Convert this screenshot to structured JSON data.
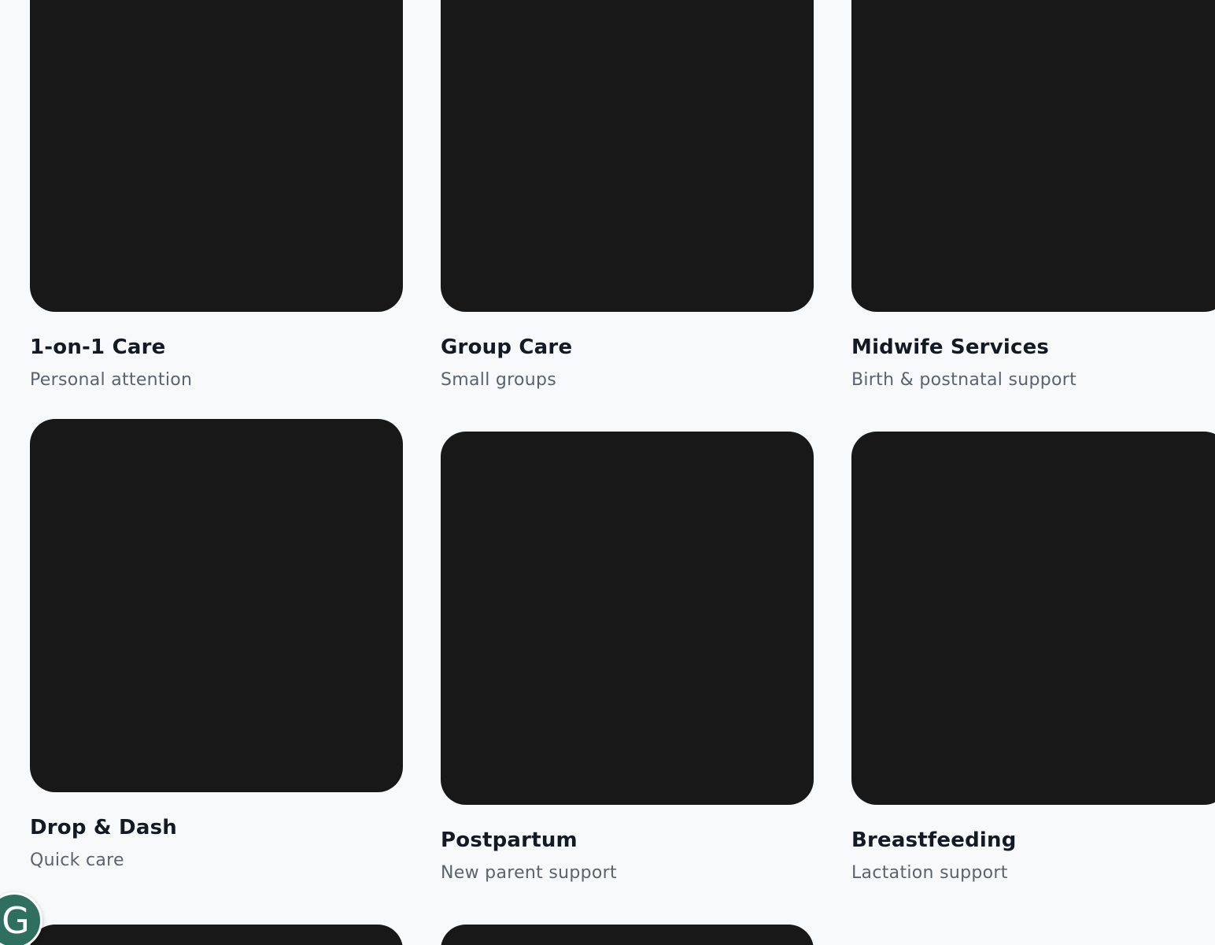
{
  "services": [
    {
      "title": "1-on-1 Care",
      "subtitle": "Personal attention"
    },
    {
      "title": "Group Care",
      "subtitle": "Small groups"
    },
    {
      "title": "Midwife Services",
      "subtitle": "Birth & postnatal support"
    },
    {
      "title": "Drop & Dash",
      "subtitle": "Quick care"
    },
    {
      "title": "Postpartum",
      "subtitle": "New parent support"
    },
    {
      "title": "Breastfeeding",
      "subtitle": "Lactation support"
    }
  ],
  "avatar": {
    "letter": "G",
    "color": "#2f6f5f"
  },
  "colors": {
    "background": "#f7f9fb",
    "card_image": "#181818",
    "title_text": "#141a24",
    "subtitle_text": "#5a636e"
  }
}
